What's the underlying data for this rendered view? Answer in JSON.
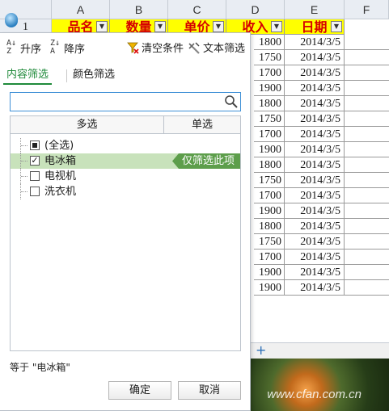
{
  "sheet": {
    "columns": [
      "A",
      "B",
      "C",
      "D",
      "E",
      "F"
    ],
    "row_number": "1",
    "headers": [
      "品名",
      "数量",
      "单价",
      "收入",
      "日期"
    ],
    "values": [
      "1800",
      "1750",
      "1700",
      "1900",
      "1800",
      "1750",
      "1700",
      "1900",
      "1800",
      "1750",
      "1700",
      "1900",
      "1800",
      "1750",
      "1700",
      "1900",
      "1900"
    ],
    "date": "2014/3/5",
    "add_sheet": "+",
    "watermark": "www.cfan.com.cn",
    "colors": {
      "header_fill": "#ffff00",
      "header_text": "#d60000"
    }
  },
  "panel": {
    "sort_asc": "升序",
    "sort_desc": "降序",
    "clear": "清空条件",
    "text_filter": "文本筛选",
    "tabs": [
      "内容筛选",
      "颜色筛选"
    ],
    "search_placeholder": "",
    "col_multi": "多选",
    "col_single": "单选",
    "items": [
      {
        "label": "(全选)",
        "state": "partial"
      },
      {
        "label": "电冰箱",
        "state": "checked",
        "selected": true
      },
      {
        "label": "电视机",
        "state": "unchecked"
      },
      {
        "label": "洗衣机",
        "state": "unchecked"
      }
    ],
    "only_this": "仅筛选此项",
    "status": "等于 \"电冰箱\"",
    "ok": "确定",
    "cancel": "取消",
    "colors": {
      "accent": "#1f8a3a",
      "selection": "#c8e2bb",
      "only_button": "#5d9e4b"
    }
  }
}
